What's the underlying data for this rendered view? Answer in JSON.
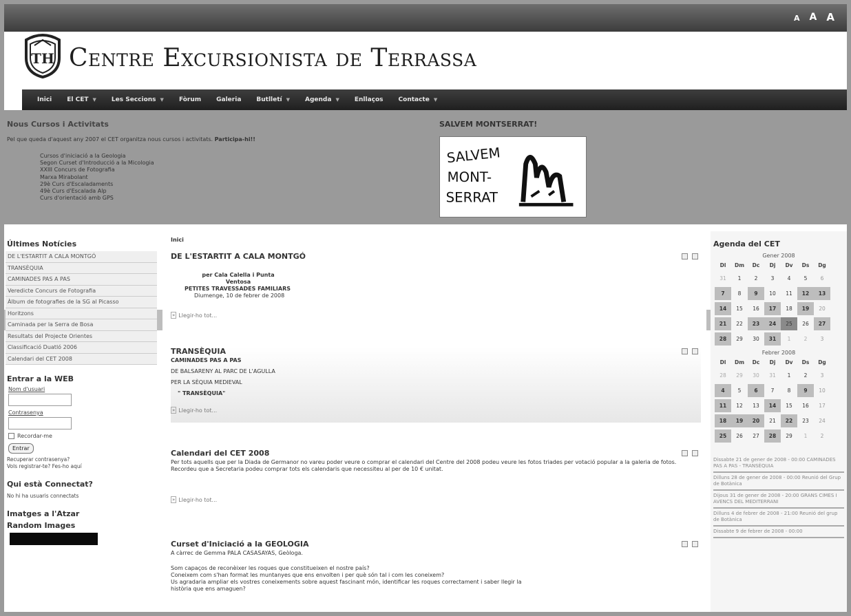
{
  "font_size_controls": [
    "A",
    "A",
    "A"
  ],
  "site": {
    "title": "Centre Excursionista de Terrassa",
    "logo_text": "TH"
  },
  "nav": [
    {
      "label": "Inici",
      "dropdown": false
    },
    {
      "label": "El CET",
      "dropdown": true
    },
    {
      "label": "Les Seccions",
      "dropdown": true
    },
    {
      "label": "Fòrum",
      "dropdown": false
    },
    {
      "label": "Galeria",
      "dropdown": false
    },
    {
      "label": "Butlletí",
      "dropdown": true
    },
    {
      "label": "Agenda",
      "dropdown": true
    },
    {
      "label": "Enllaços",
      "dropdown": false
    },
    {
      "label": "Contacte",
      "dropdown": true
    }
  ],
  "banner": {
    "title": "Nous Cursos i Activitats",
    "intro": "Pel que queda d'aquest any 2007 el CET organitza nous cursos i activitats.",
    "intro_bold": "Participa-hi!!",
    "courses": [
      "Cursos d'iniciació a la Geologia",
      "Segon Curset d'Introducció a la Micologia",
      "XXIII Concurs de Fotografia",
      "Marxa Mirabolant",
      "29è Curs d'Escaladaments",
      "49è Curs d'Escalada Alp",
      "Curs d'orientació amb GPS"
    ],
    "save_title": "SALVEM MONTSERRAT!",
    "save_image_text": [
      "SALVEM",
      "MONT-",
      "SERRAT"
    ]
  },
  "left": {
    "news_title": "Últimes Notícies",
    "news": [
      "DE L'ESTARTIT A CALA MONTGÓ",
      "TRANSÈQUIA",
      "CAMINADES PAS A PAS",
      "Veredicte Concurs de Fotografia",
      "Àlbum de fotografies de la SG al Picasso",
      "Horitzons",
      "Caminada per la Serra de Bosa",
      "Resultats del Projecte Orientes",
      "Classificació Duatló 2006",
      "Calendari del CET 2008"
    ],
    "login_title": "Entrar a la WEB",
    "username_label": "Nom d'usuari",
    "password_label": "Contrasenya",
    "remember_label": "Recordar-me",
    "login_button": "Entrar",
    "lost_password": "Recuperar contrasenya?",
    "register_q": "Vols registrar-te? Fes-ho aquí",
    "online_title": "Qui està Connectat?",
    "online_text": "No hi ha usuaris connectats",
    "images_title": "Imatges a l'Atzar",
    "random_title": "Random Images"
  },
  "main": {
    "breadcrumb": "Inici",
    "read_more": "Llegir-ho tot...",
    "articles": [
      {
        "title": "DE L'ESTARTIT A CALA MONTGÓ",
        "lines": [
          "per Cala Calella i Punta Ventosa",
          "PETITES TRAVESSADES FAMILIARS",
          "Diumenge, 10 de febrer de 2008"
        ]
      },
      {
        "title": "TRANSÈQUIA",
        "lines": [
          "CAMINADES PAS A PAS",
          "DE BALSARENY AL PARC DE L'AGULLA",
          "PER LA SÈQUIA MEDIEVAL",
          "\" TRANSÈQUIA\""
        ]
      },
      {
        "title": "Calendari del CET 2008",
        "text": "Per tots aquells que per la Diada de Germanor no vareu poder veure o comprar el calendari del Centre del 2008 podeu veure les fotos triades per votació popular a la galeria de fotos. Recordeu que a Secretaria podeu comprar tots els calendaris que necessiteu al per de 10 € unitat."
      },
      {
        "title": "Curset d'Iniciació a la GEOLOGIA",
        "byline": "A càrrec de Gemma PALA CASASAYAS, Geòloga.",
        "text_lines": [
          "Som capaços de reconèixer les roques que constitueixen el nostre país?",
          "Coneixem com s'han format les muntanyes que ens envolten i per què són tal i com les coneixem?",
          "Us agradaria ampliar els vostres coneixements sobre aquest fascinant món, identificar les roques correctament i saber llegir la",
          "història que ens amaguen?"
        ]
      }
    ]
  },
  "right": {
    "agenda_title": "Agenda del CET",
    "weekdays": [
      "Dl",
      "Dm",
      "Dc",
      "Dj",
      "Dv",
      "Ds",
      "Dg"
    ],
    "jan": {
      "title": "Gener 2008",
      "days": [
        "31",
        "1",
        "2",
        "3",
        "4",
        "5",
        "6",
        "7",
        "8",
        "9",
        "10",
        "11",
        "12",
        "13",
        "14",
        "15",
        "16",
        "17",
        "18",
        "19",
        "20",
        "21",
        "22",
        "23",
        "24",
        "25",
        "26",
        "27",
        "28",
        "29",
        "30",
        "31",
        "1",
        "2",
        "3"
      ],
      "other_month_idx": [
        0,
        32,
        33,
        34
      ],
      "event_idx": [
        7,
        9,
        12,
        13,
        14,
        17,
        19,
        21,
        23,
        24,
        27,
        28,
        31
      ],
      "today_idx": 25
    },
    "feb": {
      "title": "Febrer 2008",
      "days": [
        "28",
        "29",
        "30",
        "31",
        "1",
        "2",
        "3",
        "4",
        "5",
        "6",
        "7",
        "8",
        "9",
        "10",
        "11",
        "12",
        "13",
        "14",
        "15",
        "16",
        "17",
        "18",
        "19",
        "20",
        "21",
        "22",
        "23",
        "24",
        "25",
        "26",
        "27",
        "28",
        "29",
        "1",
        "2"
      ],
      "other_month_idx": [
        0,
        1,
        2,
        3,
        33,
        34
      ],
      "event_idx": [
        7,
        9,
        12,
        14,
        17,
        21,
        22,
        23,
        25,
        28,
        31
      ],
      "today_idx": -1
    },
    "upcoming": [
      "Dissabte 21 de gener de 2008 - 00:00 CAMINADES PAS A PAS - TRANSÈQUIA",
      "Dilluns 28 de gener de 2008 - 00:00 Reunió del Grup de Botànica",
      "Dijous 31 de gener de 2008 - 20:00 GRANS CIMES I AVENCS DEL MEDITERRANI",
      "Dilluns 4 de febrer de 2008 - 21:00 Reunió del grup de Botànica",
      "Dissabte 9 de febrer de 2008 - 00:00"
    ]
  }
}
